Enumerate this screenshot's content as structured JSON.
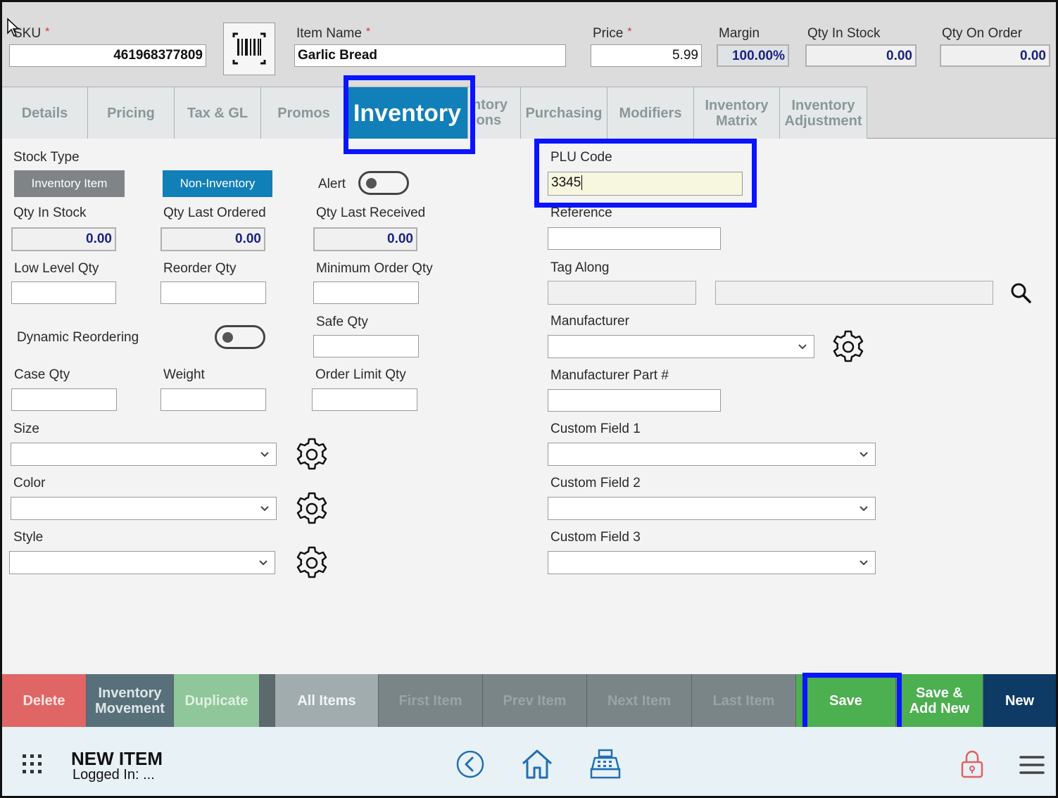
{
  "header": {
    "sku_label": "SKU",
    "sku_value": "461968377809",
    "item_name_label": "Item Name",
    "item_name_value": "Garlic Bread",
    "price_label": "Price",
    "price_value": "5.99",
    "margin_label": "Margin",
    "margin_value": "100.00%",
    "qty_in_stock_label": "Qty In Stock",
    "qty_in_stock_value": "0.00",
    "qty_on_order_label": "Qty On Order",
    "qty_on_order_value": "0.00",
    "required_mark": "*"
  },
  "tabs": [
    {
      "label": "Details"
    },
    {
      "label": "Pricing"
    },
    {
      "label": "Tax & GL"
    },
    {
      "label": "Promos"
    },
    {
      "label": "Inventory"
    },
    {
      "label_line1": "ntory",
      "label_line2": "ions"
    },
    {
      "label": "Purchasing"
    },
    {
      "label": "Modifiers"
    },
    {
      "label_line1": "Inventory",
      "label_line2": "Matrix"
    },
    {
      "label_line1": "Inventory",
      "label_line2": "Adjustment"
    }
  ],
  "left": {
    "stock_type_label": "Stock Type",
    "inventory_item_label": "Inventory Item",
    "non_inventory_label": "Non-Inventory",
    "alert_label": "Alert",
    "qty_in_stock_label": "Qty In Stock",
    "qty_in_stock_value": "0.00",
    "qty_last_ordered_label": "Qty Last Ordered",
    "qty_last_ordered_value": "0.00",
    "qty_last_received_label": "Qty Last Received",
    "qty_last_received_value": "0.00",
    "low_level_qty_label": "Low Level Qty",
    "reorder_qty_label": "Reorder Qty",
    "minimum_order_qty_label": "Minimum Order Qty",
    "safe_qty_label": "Safe Qty",
    "dynamic_reordering_label": "Dynamic Reordering",
    "case_qty_label": "Case Qty",
    "weight_label": "Weight",
    "order_limit_qty_label": "Order Limit Qty",
    "size_label": "Size",
    "color_label": "Color",
    "style_label": "Style"
  },
  "right": {
    "plu_code_label": "PLU Code",
    "plu_code_value": "3345",
    "reference_label": "Reference",
    "tag_along_label": "Tag Along",
    "manufacturer_label": "Manufacturer",
    "manufacturer_part_label": "Manufacturer Part #",
    "custom_field_1_label": "Custom Field 1",
    "custom_field_2_label": "Custom Field 2",
    "custom_field_3_label": "Custom Field 3"
  },
  "actions": {
    "delete": "Delete",
    "inventory_movement_line1": "Inventory",
    "inventory_movement_line2": "Movement",
    "duplicate": "Duplicate",
    "all_items": "All Items",
    "first_item": "First Item",
    "prev_item": "Prev Item",
    "next_item": "Next Item",
    "last_item": "Last Item",
    "save": "Save",
    "save_add_new_line1": "Save &",
    "save_add_new_line2": "Add New",
    "new": "New"
  },
  "footer": {
    "title": "NEW ITEM",
    "subtitle": "Logged In: ..."
  },
  "colors": {
    "active_tab": "#117fb8",
    "highlight": "#0a14ff",
    "save_green": "#4caf50",
    "delete_red": "#e06666",
    "new_navy": "#0d3b66"
  }
}
